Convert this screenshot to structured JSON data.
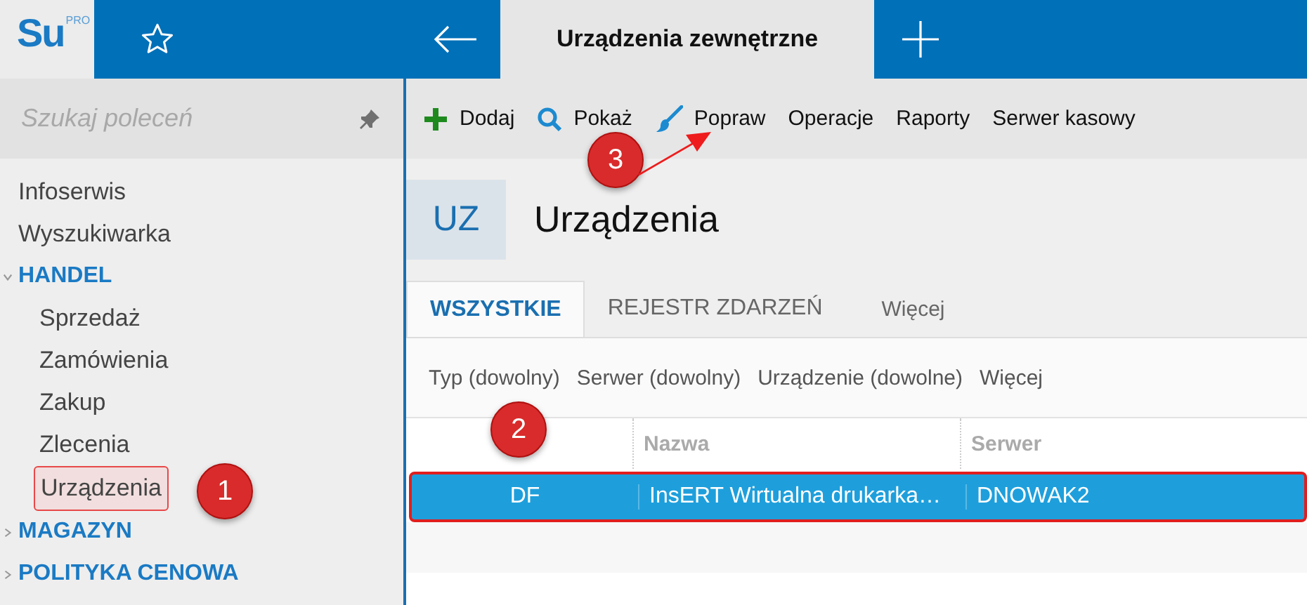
{
  "app": {
    "logo": "Su",
    "logo_badge": "PRO"
  },
  "tabs": [
    {
      "label": "Urządzenia zewnętrzne",
      "selected": true
    }
  ],
  "sidebar": {
    "search_placeholder": "Szukaj poleceń",
    "items": [
      {
        "label": "Infoserwis",
        "kind": "link",
        "selected": false
      },
      {
        "label": "Wyszukiwarka",
        "kind": "link",
        "selected": false
      },
      {
        "label": "HANDEL",
        "kind": "group",
        "expanded": true,
        "children": [
          {
            "label": "Sprzedaż",
            "selected": false
          },
          {
            "label": "Zamówienia",
            "selected": false
          },
          {
            "label": "Zakup",
            "selected": false
          },
          {
            "label": "Zlecenia",
            "selected": false
          },
          {
            "label": "Urządzenia",
            "selected": true
          }
        ]
      },
      {
        "label": "MAGAZYN",
        "kind": "group",
        "expanded": false
      },
      {
        "label": "POLITYKA CENOWA",
        "kind": "group",
        "expanded": false
      }
    ]
  },
  "toolbar": [
    {
      "label": "Dodaj",
      "kind": "add"
    },
    {
      "label": "Pokaż",
      "kind": "show"
    },
    {
      "label": "Popraw",
      "kind": "edit"
    },
    {
      "label": "Operacje",
      "kind": "plain"
    },
    {
      "label": "Raporty",
      "kind": "plain"
    },
    {
      "label": "Serwer kasowy",
      "kind": "plain"
    }
  ],
  "header": {
    "badge": "UZ",
    "title": "Urządzenia"
  },
  "view_tabs": [
    {
      "label": "WSZYSTKIE",
      "kind": "tab",
      "selected": true
    },
    {
      "label": "REJESTR ZDARZEŃ",
      "kind": "tab",
      "selected": false
    },
    {
      "label": "Więcej",
      "kind": "more",
      "selected": false
    }
  ],
  "filters": [
    "Typ (dowolny)",
    "Serwer (dowolny)",
    "Urządzenie (dowolne)",
    "Więcej"
  ],
  "table": {
    "columns": [
      "",
      "Nazwa",
      "Serwer"
    ],
    "rows": [
      {
        "cells": [
          "DF",
          "InsERT Wirtualna drukarka…",
          "DNOWAK2"
        ],
        "selected": true
      }
    ]
  },
  "annotations": [
    {
      "label": "1"
    },
    {
      "label": "2"
    },
    {
      "label": "3"
    }
  ]
}
